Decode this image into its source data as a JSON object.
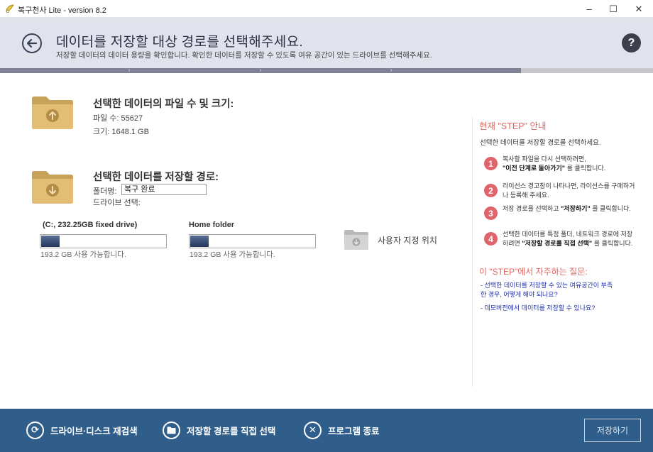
{
  "window": {
    "title": "복구천사 Lite - version 8.2",
    "minimize": "–",
    "maximize": "☐",
    "close": "✕"
  },
  "header": {
    "title": "데이터를 저장할 대상 경로를 선택해주세요.",
    "subtitle": "저장할 데이터의 데이터 용량을 확인합니다. 확인한 데이터를 저장할 수 있도록 여유 공간이 있는 드라이브를 선택해주세요.",
    "help": "?"
  },
  "selected_data": {
    "title": "선택한 데이터의 파일 수 및 크기:",
    "file_count_label": "파일 수:",
    "file_count": "55627",
    "size_label": "크기:",
    "size": "1648.1 GB"
  },
  "save_path": {
    "title": "선택한 데이터를 저장할 경로:",
    "folder_label": "폴더명:",
    "folder_value": "복구 완료",
    "drive_select_label": "드라이브 선택:"
  },
  "drives": [
    {
      "label": "(C:, 232.25GB fixed drive)",
      "free": "193.2 GB 사용 가능합니다.",
      "used_fraction": 0.15
    },
    {
      "label": "Home folder",
      "free": "193.2 GB 사용 가능합니다.",
      "used_fraction": 0.15
    }
  ],
  "custom_location": {
    "label": "사용자 지정 위치"
  },
  "guide": {
    "title": "현재 \"STEP\" 안내",
    "desc": "선택한 데이터를 저장할 경로를 선택하세요.",
    "steps": [
      {
        "num": "1",
        "pre": "복사할 파일을 다시 선택하려면,",
        "bold": "\"이전 단계로 돌아가기\"",
        "post": " 를 클릭합니다."
      },
      {
        "num": "2",
        "pre": "라이선스 경고창이 나타나면, 라이선스를 구매하거나 등록해 주세요.",
        "bold": "",
        "post": ""
      },
      {
        "num": "3",
        "pre": "저장 경로를 선택하고 ",
        "bold": "\"저장하기\"",
        "post": " 를 클릭합니다."
      },
      {
        "num": "4",
        "pre": "선택한 데이터를 특정 폴더, 네트워크 경로에 저장하려면 ",
        "bold": "\"저장할 경로를 직접 선택\"",
        "post": " 를 클릭합니다."
      }
    ],
    "faq_title": "이 \"STEP\"에서 자주하는 질문:",
    "faq": [
      "- 선택한 데이터를 저장할 수 있는 여유공간이 부족한 경우, 어떻게 해야 되나요?",
      "- 데모버전에서 데이터를 저장할 수 있나요?"
    ]
  },
  "footer": {
    "rescan": "드라이브·디스크 재검색",
    "choose_path": "저장할 경로를 직접 선택",
    "exit": "프로그램 종료",
    "save": "저장하기"
  },
  "colors": {
    "header_bg": "#e0e2ec",
    "footer_bg": "#2f5e8a",
    "accent_red": "#e0646b",
    "link_blue": "#1e2fb0",
    "folder_tan": "#d9b46a"
  }
}
